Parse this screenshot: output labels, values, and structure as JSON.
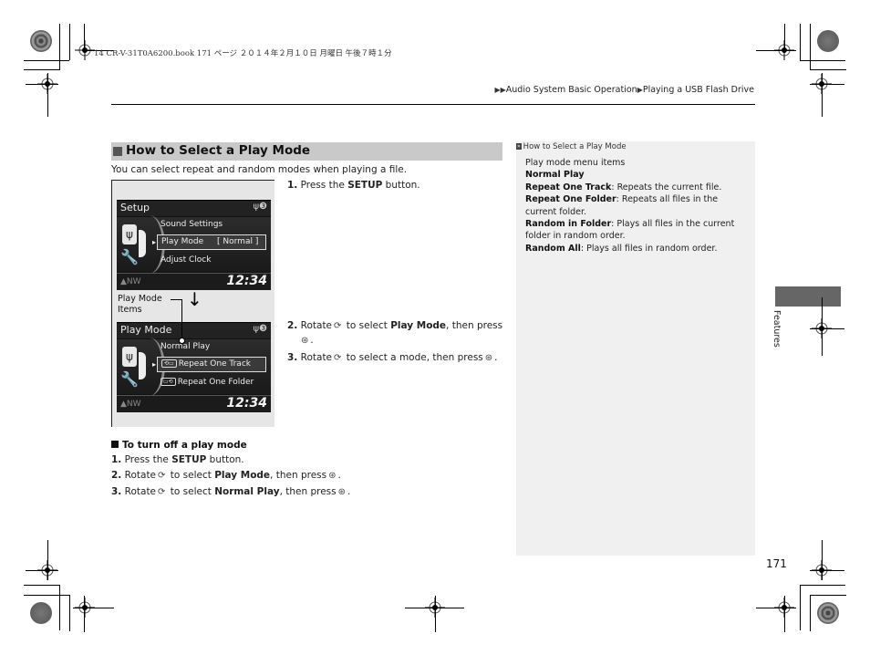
{
  "print_header": "14 CR-V-31T0A6200.book  171 ページ  ２０１４年２月１０日  月曜日  午後７時１分",
  "breadcrumb": {
    "prefix_icon": "double-right-triangle",
    "items": [
      "Audio System Basic Operation",
      "Playing a USB Flash Drive"
    ],
    "separator_icon": "right-triangle"
  },
  "section": {
    "title": "How to Select a Play Mode",
    "intro": "You can select repeat and random modes when playing a file."
  },
  "figure": {
    "screen1": {
      "title": "Setup",
      "status_icons": "usb-bluetooth",
      "items": [
        "Sound Settings",
        "Play Mode",
        "Adjust Clock"
      ],
      "selected_value": "[  Normal  ]",
      "compass": "▲NW",
      "clock": "12:34"
    },
    "callout_label_line1": "Play Mode",
    "callout_label_line2": "Items",
    "screen2": {
      "title": "Play Mode",
      "status_icons": "usb-bluetooth",
      "items": [
        "Normal Play",
        "Repeat One Track",
        "Repeat One Folder"
      ],
      "compass": "▲NW",
      "clock": "12:34"
    }
  },
  "steps": [
    {
      "num": "1.",
      "pre": "Press the ",
      "bold": "SETUP",
      "post": " button."
    },
    {
      "num": "2.",
      "pre": "Rotate",
      "mid": " to select ",
      "bold": "Play Mode",
      "post": ", then press"
    },
    {
      "num": "3.",
      "pre": "Rotate",
      "mid": " to select a mode, then press",
      "post": "."
    }
  ],
  "turn_off": {
    "heading": "To turn off a play mode",
    "steps": [
      {
        "num": "1.",
        "pre": "Press the ",
        "bold": "SETUP",
        "post": " button."
      },
      {
        "num": "2.",
        "pre": "Rotate",
        "mid": " to select ",
        "bold": "Play Mode",
        "post": ", then press"
      },
      {
        "num": "3.",
        "pre": "Rotate",
        "mid": " to select ",
        "bold": "Normal Play",
        "post": ", then press"
      }
    ]
  },
  "sidebar": {
    "ref_title": "How to Select a Play Mode",
    "intro": "Play mode menu items",
    "items": [
      {
        "term": "Normal Play",
        "desc": ""
      },
      {
        "term": "Repeat One Track",
        "desc": ": Repeats the current file."
      },
      {
        "term": "Repeat One Folder",
        "desc": ": Repeats all files in the current folder."
      },
      {
        "term": "Random in Folder",
        "desc": ": Plays all files in the current folder in random order."
      },
      {
        "term": "Random All",
        "desc": ": Plays all files in random order."
      }
    ]
  },
  "side_tab": "Features",
  "page_number": "171",
  "icons": {
    "rotate": "⟳",
    "press": "⊛"
  }
}
